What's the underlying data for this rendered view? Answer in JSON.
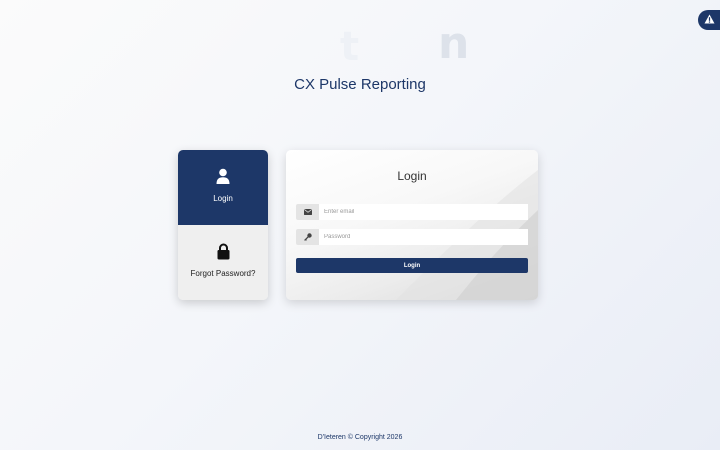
{
  "app": {
    "title": "CX Pulse Reporting"
  },
  "tabs": [
    {
      "label": "Login",
      "icon": "user-icon",
      "active": true
    },
    {
      "label": "Forgot Password?",
      "icon": "lock-icon",
      "active": false
    }
  ],
  "login_form": {
    "title": "Login",
    "email_placeholder": "Enter email",
    "password_placeholder": "Password",
    "submit_label": "Login"
  },
  "footer": {
    "text": "D'Ieteren © Copyright 2026"
  },
  "colors": {
    "primary": "#1d3768",
    "tab_inactive_bg": "#efefef",
    "addon_bg": "#e4e4e4"
  },
  "icons": {
    "alert": "warning-icon",
    "email": "envelope-icon",
    "password": "key-icon"
  }
}
